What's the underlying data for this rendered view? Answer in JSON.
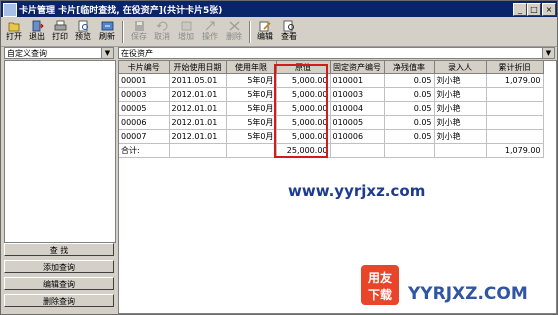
{
  "window": {
    "title": "卡片管理  卡片[临时查找, 在役资产](共计卡片5张)",
    "minimize": "_",
    "maximize": "□",
    "close": "×"
  },
  "toolbar": {
    "open": "打开",
    "exit": "退出",
    "print": "打印",
    "preview": "预览",
    "refresh": "刷新",
    "save": "保存",
    "cancel": "取消",
    "add": "增加",
    "operate": "操作",
    "delete": "删除",
    "edit": "编辑",
    "view": "查看"
  },
  "left": {
    "query_select": "自定义查询",
    "buttons": {
      "find": "查   找",
      "add": "添加查询",
      "edit": "编辑查询",
      "delete": "删除查询"
    }
  },
  "main": {
    "filter_select": "在役资产",
    "columns": [
      "卡片编号",
      "开始使用日期",
      "使用年限",
      "原值",
      "固定资产编号",
      "净残值率",
      "录入人",
      "累计折旧"
    ],
    "rows": [
      [
        "00001",
        "2011.05.01",
        "5年0月",
        "5,000.00",
        "010001",
        "0.05",
        "刘小艳",
        "1,079.00"
      ],
      [
        "00003",
        "2012.01.01",
        "5年0月",
        "5,000.00",
        "010003",
        "0.05",
        "刘小艳",
        ""
      ],
      [
        "00005",
        "2012.01.01",
        "5年0月",
        "5,000.00",
        "010004",
        "0.05",
        "刘小艳",
        ""
      ],
      [
        "00006",
        "2012.01.01",
        "5年0月",
        "5,000.00",
        "010005",
        "0.05",
        "刘小艳",
        ""
      ],
      [
        "00007",
        "2012.01.01",
        "5年0月",
        "5,000.00",
        "010006",
        "0.05",
        "刘小艳",
        ""
      ]
    ],
    "total": {
      "label": "合计:",
      "original_value": "25,000.00",
      "accumulated_depreciation": "1,079.00"
    }
  },
  "watermark": {
    "url": "www.yyrjxz.com",
    "brand": "YYRJXZ.COM",
    "logo_top": "用友",
    "logo_bottom": "下载"
  }
}
